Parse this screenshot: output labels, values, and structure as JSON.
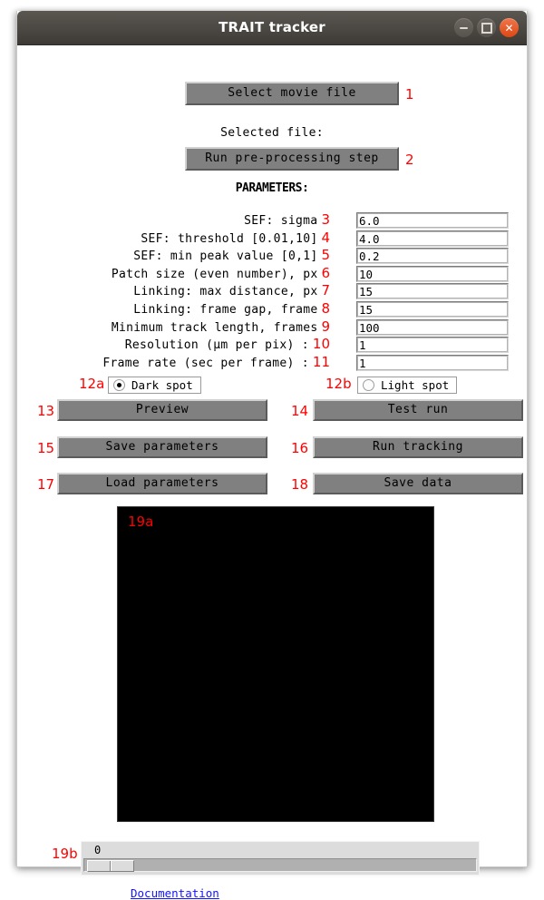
{
  "window": {
    "title": "TRAIT tracker",
    "controls": [
      {
        "name": "minimize-button",
        "icon": "minimize-icon",
        "label": "−"
      },
      {
        "name": "maximize-button",
        "icon": "maximize-icon",
        "label": "□"
      },
      {
        "name": "close-button",
        "icon": "close-icon",
        "label": "×"
      }
    ]
  },
  "top": {
    "select_movie_button": "Select movie file",
    "select_movie_num": "1",
    "selected_file_label": "Selected file:",
    "preprocess_button": "Run pre-processing step",
    "preprocess_num": "2",
    "parameters_heading": "PARAMETERS:"
  },
  "parameters": {
    "rows": [
      {
        "label": "SEF: sigma",
        "num": "3",
        "value": "6.0"
      },
      {
        "label": "SEF: threshold [0.01,10]",
        "num": "4",
        "value": "4.0"
      },
      {
        "label": "SEF: min peak value [0,1]",
        "num": "5",
        "value": "0.2"
      },
      {
        "label": "Patch size (even number), px",
        "num": "6",
        "value": "10"
      },
      {
        "label": "Linking: max distance, px",
        "num": "7",
        "value": "15"
      },
      {
        "label": "Linking: frame gap, frame",
        "num": "8",
        "value": "15"
      },
      {
        "label": "Minimum track length, frames",
        "num": "9",
        "value": "100"
      },
      {
        "label": "Resolution (μm per pix) :",
        "num": "10",
        "value": "1"
      },
      {
        "label": "Frame rate (sec per frame) :",
        "num": "11",
        "value": "1"
      }
    ]
  },
  "spot_mode": {
    "dark": {
      "num": "12a",
      "label": "Dark spot",
      "selected": true
    },
    "light": {
      "num": "12b",
      "label": "Light spot",
      "selected": false
    }
  },
  "actions": [
    {
      "num": "13",
      "label": "Preview"
    },
    {
      "num": "14",
      "label": "Test run"
    },
    {
      "num": "15",
      "label": "Save parameters"
    },
    {
      "num": "16",
      "label": "Run tracking"
    },
    {
      "num": "17",
      "label": "Load parameters"
    },
    {
      "num": "18",
      "label": "Save data"
    }
  ],
  "canvas": {
    "num": "19a"
  },
  "scale": {
    "num": "19b",
    "value": "0"
  },
  "footer": {
    "documentation_link": "Documentation"
  },
  "colors": {
    "annotation_red": "#ff0000",
    "button_face": "#808080",
    "titlebar": "#4b4742",
    "close_button": "#dd4814",
    "link_blue": "#1414ff",
    "canvas_black": "#000000"
  }
}
